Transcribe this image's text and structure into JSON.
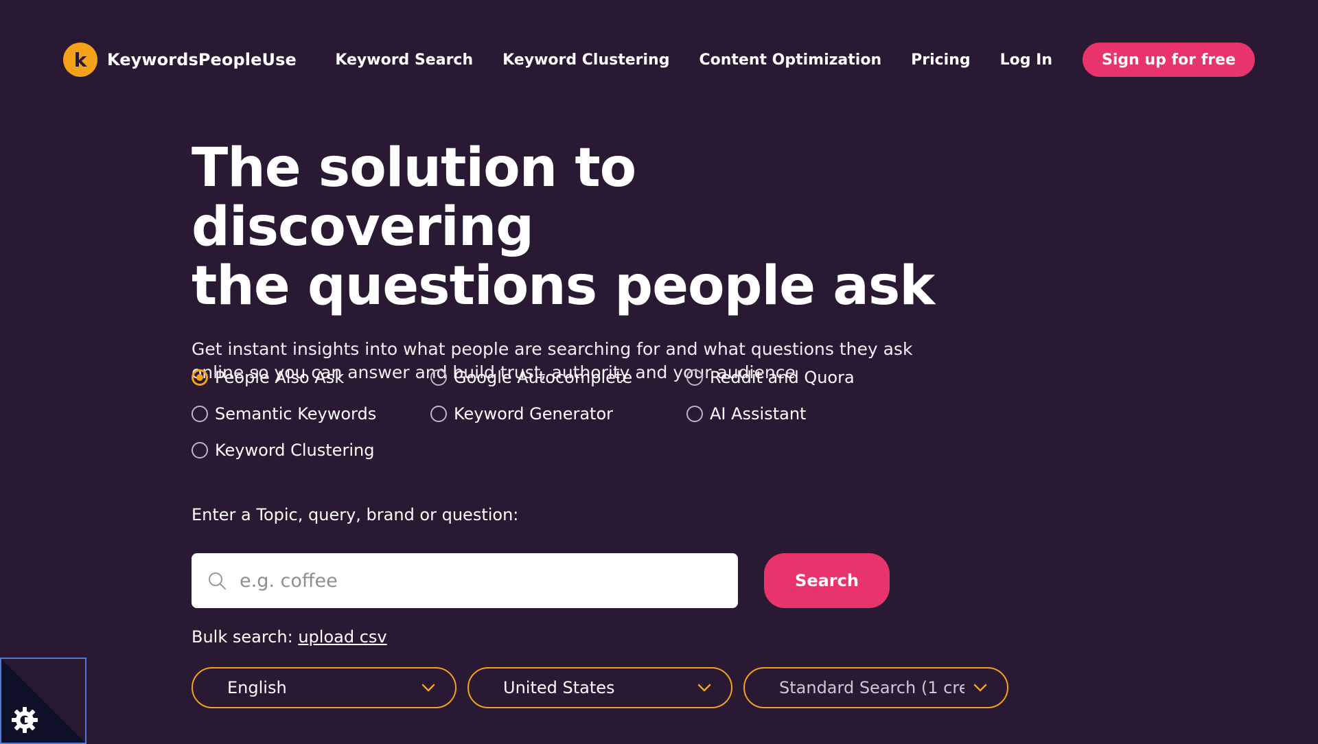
{
  "brand": {
    "logo_letter": "k",
    "name": "KeywordsPeopleUse"
  },
  "nav": {
    "items": [
      "Keyword Search",
      "Keyword Clustering",
      "Content Optimization",
      "Pricing",
      "Log In"
    ],
    "signup_label": "Sign up for free"
  },
  "hero": {
    "title_line1": "The solution to discovering",
    "title_line2": "the questions people ask",
    "subtitle": "Get instant insights into what people are searching for and what questions they ask online so you can answer and build trust, authority and your audience"
  },
  "options": [
    {
      "label": "People Also Ask",
      "checked": true
    },
    {
      "label": "Google Autocomplete",
      "checked": false
    },
    {
      "label": "Reddit and Quora",
      "checked": false
    },
    {
      "label": "Semantic Keywords",
      "checked": false
    },
    {
      "label": "Keyword Generator",
      "checked": false
    },
    {
      "label": "AI Assistant",
      "checked": false
    },
    {
      "label": "Keyword Clustering",
      "checked": false
    }
  ],
  "search": {
    "label": "Enter a Topic, query, brand or question:",
    "placeholder": "e.g. coffee",
    "value": "",
    "button_label": "Search"
  },
  "bulk": {
    "prefix": "Bulk search:",
    "link_label": "upload csv"
  },
  "selects": {
    "language": "English",
    "country": "United States",
    "mode": "Standard Search (1 cre"
  },
  "colors": {
    "background": "#2a1932",
    "accent_pink": "#e8336b",
    "accent_orange": "#f5a21b"
  },
  "icons": {
    "search": "search-icon",
    "chevron": "chevron-down-icon",
    "cookie": "gear-icon"
  }
}
